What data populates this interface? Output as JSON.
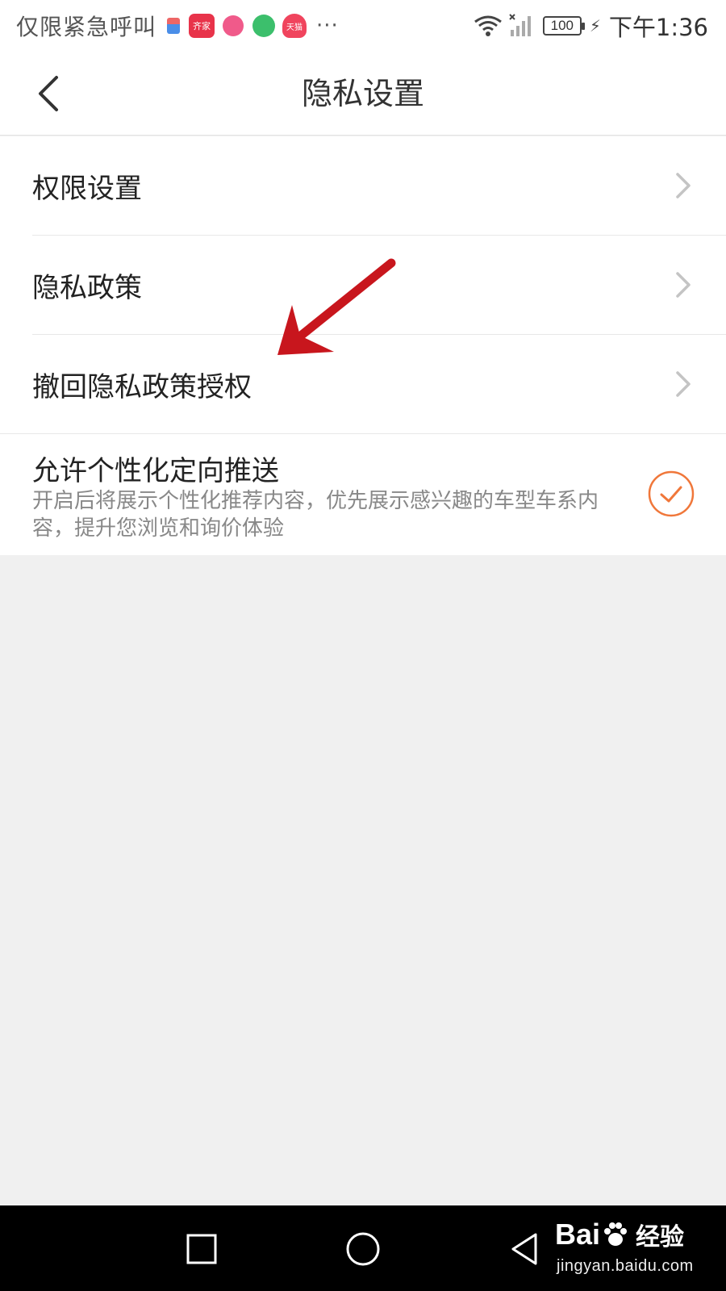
{
  "status_bar": {
    "carrier": "仅限紧急呼叫",
    "notification_icons": [
      "gift-icon",
      "qijia-app-icon",
      "pink-app-icon",
      "green-app-icon",
      "tmall-app-icon"
    ],
    "qijia_text": "齐家",
    "tmall_text": "天猫",
    "more": "···",
    "battery": "100",
    "time": "下午1:36"
  },
  "header": {
    "title": "隐私设置",
    "back_icon": "chevron-left-icon"
  },
  "settings": {
    "items": [
      {
        "label": "权限设置"
      },
      {
        "label": "隐私政策"
      },
      {
        "label": "撤回隐私政策授权"
      }
    ],
    "personalized_push": {
      "title": "允许个性化定向推送",
      "description": "开启后将展示个性化推荐内容，优先展示感兴趣的车型车系内容，提升您浏览和询价体验",
      "checked": true
    }
  },
  "colors": {
    "accent": "#f0773a",
    "annotation_arrow": "#c8161d",
    "chevron": "#c4c4c4"
  },
  "watermark": {
    "logo_left": "Bai",
    "logo_right": "经验",
    "url": "jingyan.baidu.com"
  }
}
